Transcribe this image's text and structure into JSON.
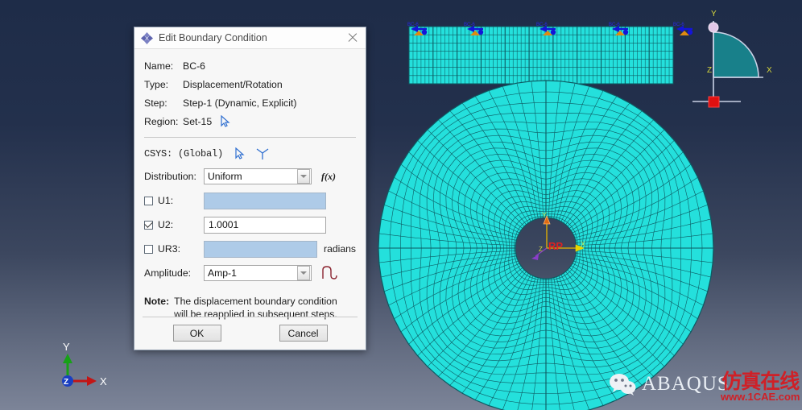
{
  "window": {
    "background_top": "#1e2c48",
    "background_bottom": "#7c8498",
    "mesh_color": "#24e0dc",
    "mesh_line_color": "#0d5a62"
  },
  "dialog": {
    "title": "Edit Boundary Condition",
    "icon": "abaqus-diamond-icon",
    "close_icon": "close-icon",
    "fields": [
      {
        "label": "Name:",
        "value": "BC-6"
      },
      {
        "label": "Type:",
        "value": "Displacement/Rotation"
      },
      {
        "label": "Step:",
        "value": "Step-1 (Dynamic, Explicit)"
      },
      {
        "label": "Region:",
        "value": "Set-15"
      }
    ],
    "csys": {
      "label": "CSYS:",
      "value": "(Global)",
      "pick_icon": "cursor-arrow-icon",
      "datum_icon": "datum-csys-icon"
    },
    "distribution": {
      "label": "Distribution:",
      "value": "Uniform",
      "fx_label": "f(x)"
    },
    "dofs": [
      {
        "name": "U1:",
        "checked": false,
        "value": "",
        "enabled": false,
        "unit": ""
      },
      {
        "name": "U2:",
        "checked": true,
        "value": "1.0001",
        "enabled": true,
        "unit": ""
      },
      {
        "name": "UR3:",
        "checked": false,
        "value": "",
        "enabled": false,
        "unit": "radians"
      }
    ],
    "amplitude": {
      "label": "Amplitude:",
      "value": "Amp-1",
      "icon": "amplitude-wave-icon"
    },
    "note": {
      "prefix": "Note:",
      "line1": "The displacement boundary condition",
      "line2": "will be reapplied in subsequent steps."
    },
    "buttons": {
      "ok": "OK",
      "cancel": "Cancel"
    }
  },
  "viewport": {
    "triad": {
      "x": "X",
      "y": "Y",
      "z": "Z",
      "x_color": "#c31515",
      "y_color": "#17a117",
      "z_color": "#1a3fc0"
    },
    "geometry_triad": {
      "x": "X",
      "y": "Y",
      "z": "Z"
    },
    "part_triad": {
      "x": "X",
      "y": "Y",
      "z": "Z",
      "label": "RP"
    },
    "bc_marker_label": "BC-6",
    "bc_marker_count": 5,
    "watermark_faint": "1CAE"
  },
  "logo": {
    "wechat_icon": "wechat-icon",
    "brand": "ABAQUS",
    "watermark_cn": "仿真在线",
    "watermark_url": "www.1CAE.com"
  }
}
